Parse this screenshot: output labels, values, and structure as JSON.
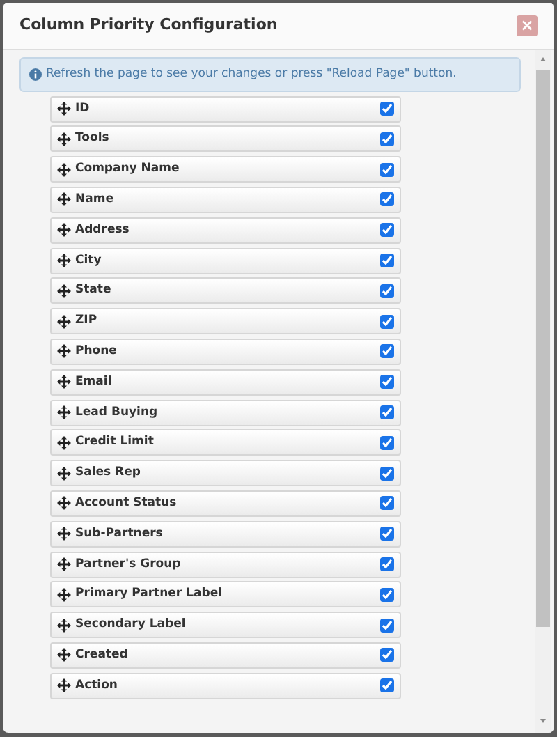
{
  "dialog": {
    "title": "Column Priority Configuration",
    "close": "×"
  },
  "notice": {
    "text": "Refresh the page to see your changes or press \"Reload Page\" button."
  },
  "columns": [
    {
      "label": "ID",
      "checked": true
    },
    {
      "label": "Tools",
      "checked": true
    },
    {
      "label": "Company Name",
      "checked": true
    },
    {
      "label": "Name",
      "checked": true
    },
    {
      "label": "Address",
      "checked": true
    },
    {
      "label": "City",
      "checked": true
    },
    {
      "label": "State",
      "checked": true
    },
    {
      "label": "ZIP",
      "checked": true
    },
    {
      "label": "Phone",
      "checked": true
    },
    {
      "label": "Email",
      "checked": true
    },
    {
      "label": "Lead Buying",
      "checked": true
    },
    {
      "label": "Credit Limit",
      "checked": true
    },
    {
      "label": "Sales Rep",
      "checked": true
    },
    {
      "label": "Account Status",
      "checked": true
    },
    {
      "label": "Sub-Partners",
      "checked": true
    },
    {
      "label": "Partner's Group",
      "checked": true
    },
    {
      "label": "Primary Partner Label",
      "checked": true
    },
    {
      "label": "Secondary Label",
      "checked": true
    },
    {
      "label": "Created",
      "checked": true
    },
    {
      "label": "Action",
      "checked": true
    }
  ]
}
